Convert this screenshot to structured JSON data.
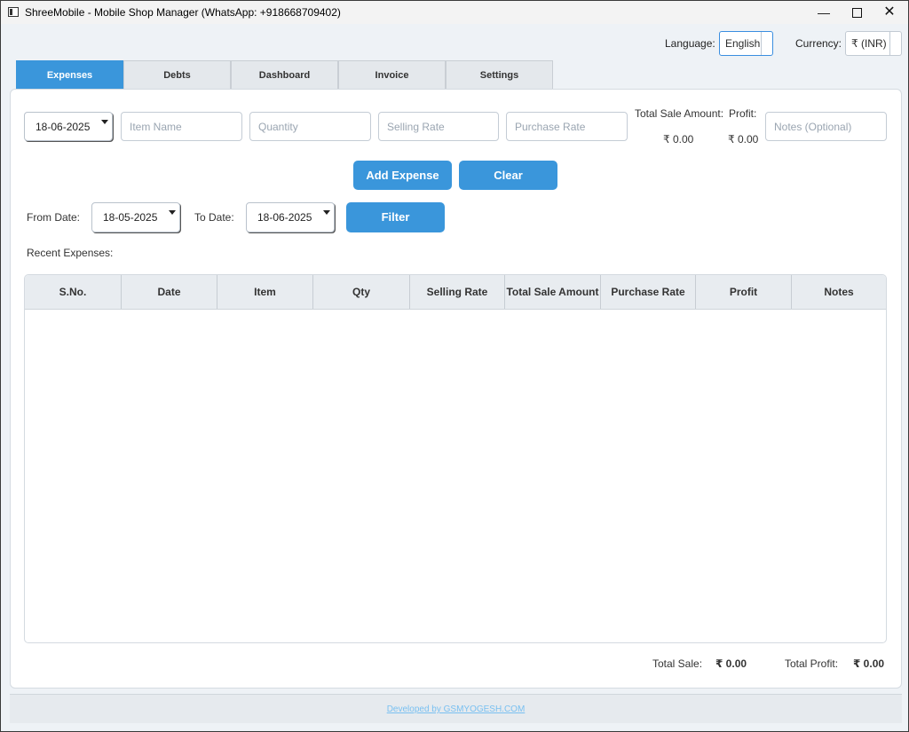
{
  "window": {
    "title": "ShreeMobile - Mobile Shop Manager (WhatsApp: +918668709402)"
  },
  "top": {
    "language_label": "Language:",
    "language_value": "English",
    "currency_label": "Currency:",
    "currency_value": "₹ (INR)"
  },
  "tabs": [
    {
      "label": "Expenses",
      "active": true
    },
    {
      "label": "Debts",
      "active": false
    },
    {
      "label": "Dashboard",
      "active": false
    },
    {
      "label": "Invoice",
      "active": false
    },
    {
      "label": "Settings",
      "active": false
    }
  ],
  "form": {
    "date": "18-06-2025",
    "item_placeholder": "Item Name",
    "qty_placeholder": "Quantity",
    "selling_placeholder": "Selling Rate",
    "purchase_placeholder": "Purchase Rate",
    "total_sale_label": "Total Sale Amount:",
    "total_sale_value": "₹ 0.00",
    "profit_label": "Profit:",
    "profit_value": "₹ 0.00",
    "notes_placeholder": "Notes (Optional)",
    "add_button": "Add Expense",
    "clear_button": "Clear"
  },
  "filter": {
    "from_label": "From Date:",
    "from_value": "18-05-2025",
    "to_label": "To Date:",
    "to_value": "18-06-2025",
    "button": "Filter"
  },
  "recent": {
    "label": "Recent Expenses:"
  },
  "table": {
    "columns": [
      "S.No.",
      "Date",
      "Item",
      "Qty",
      "Selling Rate",
      "Total Sale Amount",
      "Purchase Rate",
      "Profit",
      "Notes"
    ]
  },
  "totals": {
    "sale_label": "Total Sale:",
    "sale_value": "₹ 0.00",
    "profit_label": "Total Profit:",
    "profit_value": "₹ 0.00"
  },
  "footer": {
    "link": "Developed by GSMYOGESH.COM"
  }
}
